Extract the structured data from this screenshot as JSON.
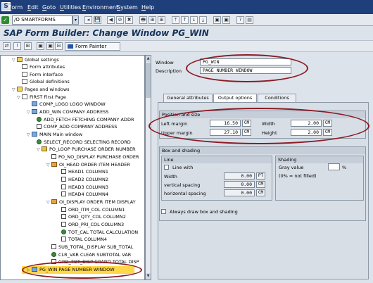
{
  "window_icon": "S",
  "menubar": {
    "items": [
      {
        "u": "F",
        "rest": "orm"
      },
      {
        "u": "E",
        "rest": "dit"
      },
      {
        "u": "G",
        "rest": "oto"
      },
      {
        "u": "U",
        "rest": "tilities"
      },
      {
        "u": "E",
        "rest": "nvironment"
      },
      {
        "u": "S",
        "rest": "ystem"
      },
      {
        "u": "H",
        "rest": "elp"
      }
    ]
  },
  "toolbar": {
    "ok": "✓",
    "command": "/O SMARTFORMS",
    "dropdown_arrow": "▾",
    "icons": [
      "◂",
      "💾",
      "◀",
      "⊘",
      "✖",
      "🖶",
      "⊞",
      "⊞",
      "⤒",
      "↑",
      "↓",
      "⤓",
      "▣",
      "▣",
      "?",
      "▤"
    ]
  },
  "title": "SAP Form Builder: Change Window PG_WIN",
  "app_toolbar": {
    "icons": [
      "⇄",
      "!",
      "⊞",
      "▣",
      "▣",
      "⊟"
    ],
    "form_painter": "Form Painter"
  },
  "tree": {
    "nodes": [
      {
        "label": "Global settings",
        "icon": "folder",
        "tw": "▽"
      },
      {
        "label": "Form attributes",
        "icon": "page",
        "tw": ""
      },
      {
        "label": "Form interface",
        "icon": "page",
        "tw": ""
      },
      {
        "label": "Global definitions",
        "icon": "page",
        "tw": ""
      },
      {
        "label": "Pages and windows",
        "icon": "folder",
        "tw": "▽"
      },
      {
        "label": "FIRST First Page",
        "icon": "page",
        "tw": "▽"
      },
      {
        "label": "COMP_LOGO LOGO WINDOW",
        "icon": "win",
        "tw": ""
      },
      {
        "label": "ADD_WIN COMPANY ADDRESS",
        "icon": "win",
        "tw": "▽"
      },
      {
        "label": "ADD_FETCH FETCHING COMPANY ADDR",
        "icon": "cmd",
        "tw": ""
      },
      {
        "label": "COMP_ADD COMPANY ADDRESS",
        "icon": "txt",
        "tw": ""
      },
      {
        "label": "MAIN Main window",
        "icon": "win",
        "tw": "▽"
      },
      {
        "label": "SELECT_RECORD SELECTING RECORD",
        "icon": "cmd",
        "tw": ""
      },
      {
        "label": "PO_LOOP PURCHASE ORDER NUMBER",
        "icon": "loop",
        "tw": "▽"
      },
      {
        "label": "PO_NO_DISPLAY PURCHASE ORDER",
        "icon": "txt",
        "tw": ""
      },
      {
        "label": "OI_HEAD ORDER ITEM HEADER",
        "icon": "tbl",
        "tw": "▽"
      },
      {
        "label": "HEAD1 COLUMN1",
        "icon": "txt",
        "tw": ""
      },
      {
        "label": "HEAD2 COLUMN2",
        "icon": "txt",
        "tw": ""
      },
      {
        "label": "HEAD3 COLUMN3",
        "icon": "txt",
        "tw": ""
      },
      {
        "label": "HEAD4 COLUMN4",
        "icon": "txt",
        "tw": ""
      },
      {
        "label": "OI_DISPLAY ORDER ITEM DISPLAY",
        "icon": "tbl",
        "tw": "▽"
      },
      {
        "label": "ORD_ITM_COL COLUMN1",
        "icon": "txt",
        "tw": ""
      },
      {
        "label": "ORD_QTY_COL COLUMN2",
        "icon": "txt",
        "tw": ""
      },
      {
        "label": "ORD_PRI_COL COLUMN3",
        "icon": "txt",
        "tw": ""
      },
      {
        "label": "TOT_CAL TOTAL CALCULATION",
        "icon": "cmd",
        "tw": ""
      },
      {
        "label": "TOTAL COLUMN4",
        "icon": "txt",
        "tw": ""
      },
      {
        "label": "SUB_TOTAL_DISPLAY SUB_TOTAL",
        "icon": "txt",
        "tw": ""
      },
      {
        "label": "CLR_VAR CLEAR SUBTOTAL VAR",
        "icon": "cmd",
        "tw": ""
      },
      {
        "label": "GRD_TOT_DISP GRAND TOTAL DISP",
        "icon": "txt",
        "tw": ""
      },
      {
        "label": "PG_WIN PAGE NUMBER WINDOW",
        "icon": "win",
        "tw": "▷"
      }
    ]
  },
  "scrollbar": {
    "up": "▲",
    "down": "▼"
  },
  "window_field": {
    "label": "Window",
    "value": "PG_WIN"
  },
  "description_field": {
    "label": "Description",
    "value": "PAGE NUMBER WINDOW"
  },
  "tabs": [
    "General attributes",
    "Output options",
    "Conditions"
  ],
  "position_group": {
    "title": "Position and size",
    "left_margin": {
      "label": "Left margin",
      "value": "16.50",
      "unit": "CM"
    },
    "upper_margin": {
      "label": "Upper margin",
      "value": "27.10",
      "unit": "CM"
    },
    "width": {
      "label": "Width",
      "value": "2.00",
      "unit": "CM"
    },
    "height": {
      "label": "Height",
      "value": "2.00",
      "unit": "CM"
    }
  },
  "box_group": {
    "title": "Box and shading",
    "line": {
      "title": "Line",
      "line_with": "Line with",
      "width_label": "Width",
      "width_value": "0.00",
      "width_unit": "PT",
      "vertical_label": "vertical spacing",
      "vertical_value": "0.00",
      "vertical_unit": "CM",
      "horizontal_label": "horizontal spacing",
      "horizontal_value": "0.00",
      "horizontal_unit": "CM"
    },
    "shading": {
      "title": "Shading",
      "gray_label": "Gray value",
      "gray_unit": "%",
      "note": "(0% = not filled)"
    },
    "always_draw": "Always draw box and shading"
  },
  "colors": {
    "highlight_oval": "#8c1b24",
    "title_blue": "#16325c",
    "selected_node": "#ffd84a"
  }
}
